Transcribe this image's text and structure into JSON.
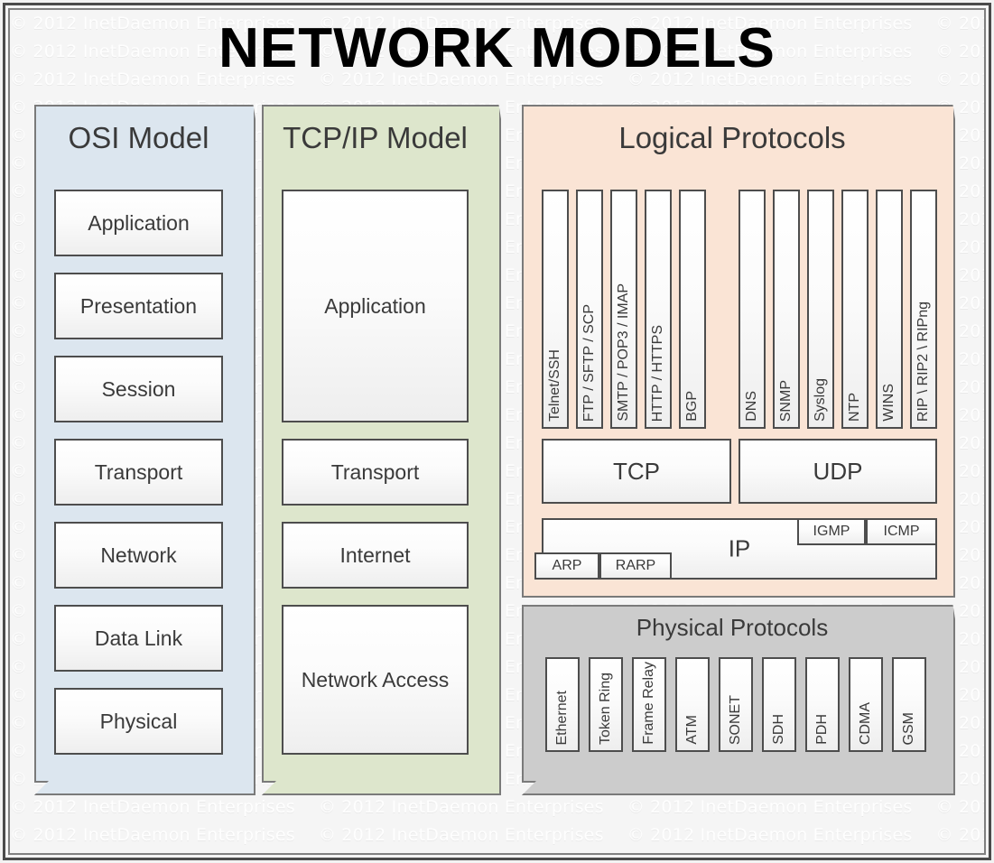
{
  "title": "NETWORK MODELS",
  "watermark": {
    "text": "© 2012 InetDaemon Enterprises",
    "rows": 30,
    "repeats_per_row": 5
  },
  "colors": {
    "osi_panel": "#dce6ef",
    "tcpip_panel": "#dde6cc",
    "logical_panel": "#fae4d5",
    "physical_panel": "#cccccc",
    "box_border": "#4d4d4d",
    "panel_border": "#7a7a7a",
    "text": "#3a3a3a",
    "frame": "#4a4a4a"
  },
  "osi": {
    "title": "OSI Model",
    "layers": [
      {
        "label": "Application"
      },
      {
        "label": "Presentation"
      },
      {
        "label": "Session"
      },
      {
        "label": "Transport"
      },
      {
        "label": "Network"
      },
      {
        "label": "Data Link"
      },
      {
        "label": "Physical"
      }
    ]
  },
  "tcpip": {
    "title": "TCP/IP Model",
    "layers": [
      {
        "label": "Application"
      },
      {
        "label": "Transport"
      },
      {
        "label": "Internet"
      },
      {
        "label": "Network Access"
      }
    ]
  },
  "logical": {
    "title": "Logical Protocols",
    "tcp_apps": [
      {
        "label": "Telnet/SSH"
      },
      {
        "label": "FTP / SFTP / SCP"
      },
      {
        "label": "SMTP / POP3 / IMAP"
      },
      {
        "label": "HTTP / HTTPS"
      },
      {
        "label": "BGP"
      }
    ],
    "udp_apps": [
      {
        "label": "DNS"
      },
      {
        "label": "SNMP"
      },
      {
        "label": "Syslog"
      },
      {
        "label": "NTP"
      },
      {
        "label": "WINS"
      },
      {
        "label": "RIP \\ RIP2 \\ RIPng"
      }
    ],
    "transport": [
      {
        "label": "TCP"
      },
      {
        "label": "UDP"
      }
    ],
    "internet": {
      "ip_label": "IP",
      "top_right": [
        {
          "label": "IGMP"
        },
        {
          "label": "ICMP"
        }
      ],
      "bottom_left": [
        {
          "label": "ARP"
        },
        {
          "label": "RARP"
        }
      ]
    }
  },
  "physical": {
    "title": "Physical Protocols",
    "protocols": [
      {
        "label": "Ethernet"
      },
      {
        "label": "Token Ring"
      },
      {
        "label": "Frame Relay"
      },
      {
        "label": "ATM"
      },
      {
        "label": "SONET"
      },
      {
        "label": "SDH"
      },
      {
        "label": "PDH"
      },
      {
        "label": "CDMA"
      },
      {
        "label": "GSM"
      }
    ]
  }
}
